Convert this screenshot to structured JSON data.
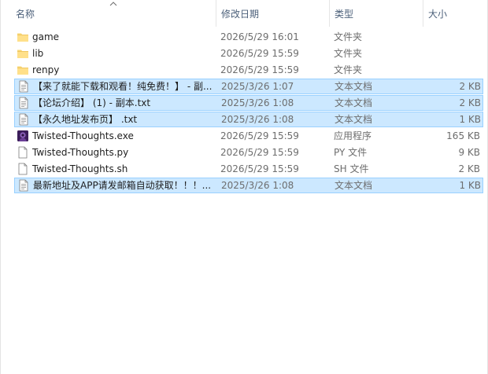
{
  "columns": {
    "name": "名称",
    "date": "修改日期",
    "type": "类型",
    "size": "大小"
  },
  "files": [
    {
      "name": "game",
      "date": "2026/5/29 16:01",
      "type": "文件夹",
      "size": "",
      "icon": "folder-icon",
      "selected": false
    },
    {
      "name": "lib",
      "date": "2026/5/29 15:59",
      "type": "文件夹",
      "size": "",
      "icon": "folder-icon",
      "selected": false
    },
    {
      "name": "renpy",
      "date": "2026/5/29 15:59",
      "type": "文件夹",
      "size": "",
      "icon": "folder-icon",
      "selected": false
    },
    {
      "name": "【来了就能下载和观看！纯免费！】 - 副...",
      "date": "2025/3/26 1:07",
      "type": "文本文档",
      "size": "2 KB",
      "icon": "text-file-icon",
      "selected": true
    },
    {
      "name": "【论坛介绍】 (1) - 副本.txt",
      "date": "2025/3/26 1:08",
      "type": "文本文档",
      "size": "2 KB",
      "icon": "text-file-icon",
      "selected": true
    },
    {
      "name": "【永久地址发布页】 .txt",
      "date": "2025/3/26 1:08",
      "type": "文本文档",
      "size": "1 KB",
      "icon": "text-file-icon",
      "selected": true
    },
    {
      "name": "Twisted-Thoughts.exe",
      "date": "2026/5/29 15:59",
      "type": "应用程序",
      "size": "165 KB",
      "icon": "app-icon",
      "selected": false
    },
    {
      "name": "Twisted-Thoughts.py",
      "date": "2026/5/29 15:59",
      "type": "PY 文件",
      "size": "9 KB",
      "icon": "blank-file-icon",
      "selected": false
    },
    {
      "name": "Twisted-Thoughts.sh",
      "date": "2026/5/29 15:59",
      "type": "SH 文件",
      "size": "2 KB",
      "icon": "blank-file-icon",
      "selected": false
    },
    {
      "name": "最新地址及APP请发邮箱自动获取！！！...",
      "date": "2025/3/26 1:08",
      "type": "文本文档",
      "size": "1 KB",
      "icon": "text-file-icon",
      "selected": true
    }
  ],
  "colors": {
    "selected_bg": "#cce8ff",
    "selected_border": "#99d1ff",
    "header_text": "#4c607a",
    "folder": "#f8d775"
  }
}
